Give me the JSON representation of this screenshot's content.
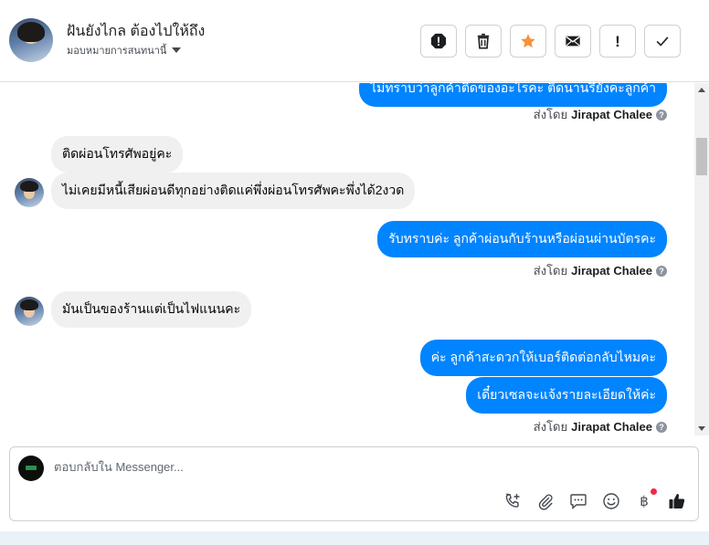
{
  "header": {
    "contact_name": "ฝันยังไกล ต้องไปให้ถึง",
    "assign_label": "มอบหมายการสนทนานี้"
  },
  "actions": [
    {
      "name": "report-icon"
    },
    {
      "name": "trash-icon"
    },
    {
      "name": "star-icon",
      "color": "#f7923b"
    },
    {
      "name": "envelope-icon"
    },
    {
      "name": "exclamation-icon",
      "label": "!"
    },
    {
      "name": "checkmark-icon"
    }
  ],
  "thread": {
    "sent_by_prefix": "ส่งโดย",
    "agent_name": "Jirapat Chalee",
    "help_glyph": "?",
    "messages": [
      {
        "dir": "out",
        "text": "ไม่ทราบว่าลูกค้าติดของอะไรคะ ติดนานรึยังคะลูกค้า"
      },
      {
        "dir": "in",
        "text": "ติดผ่อนโทรศัพอยู่คะ"
      },
      {
        "dir": "in",
        "text": "ไม่เคยมีหนี้เสียผ่อนดีทุกอย่างติดแค่พึ่งผ่อนโทรศัพคะพึ่งได้2งวด"
      },
      {
        "dir": "out",
        "text": "รับทราบค่ะ ลูกค้าผ่อนกับร้านหรือผ่อนผ่านบัตรคะ"
      },
      {
        "dir": "in",
        "text": "มันเป็นของร้านแต่เป็นไฟแนนคะ"
      },
      {
        "dir": "out",
        "text": "ค่ะ ลูกค้าสะดวกให้เบอร์ติดต่อกลับไหมคะ"
      },
      {
        "dir": "out",
        "text": "เดี๋ยวเซลจะแจ้งรายละเอียดให้ค่ะ"
      }
    ]
  },
  "composer": {
    "placeholder": "ตอบกลับใน Messenger...",
    "tools": [
      "call-add-icon",
      "paperclip-icon",
      "saved-reply-icon",
      "emoji-icon",
      "baht-icon",
      "like-icon"
    ],
    "baht_glyph": "฿"
  },
  "colors": {
    "outgoing_bubble": "#0084ff",
    "incoming_bubble": "#f0f0f0",
    "notification_dot": "#f02849"
  }
}
